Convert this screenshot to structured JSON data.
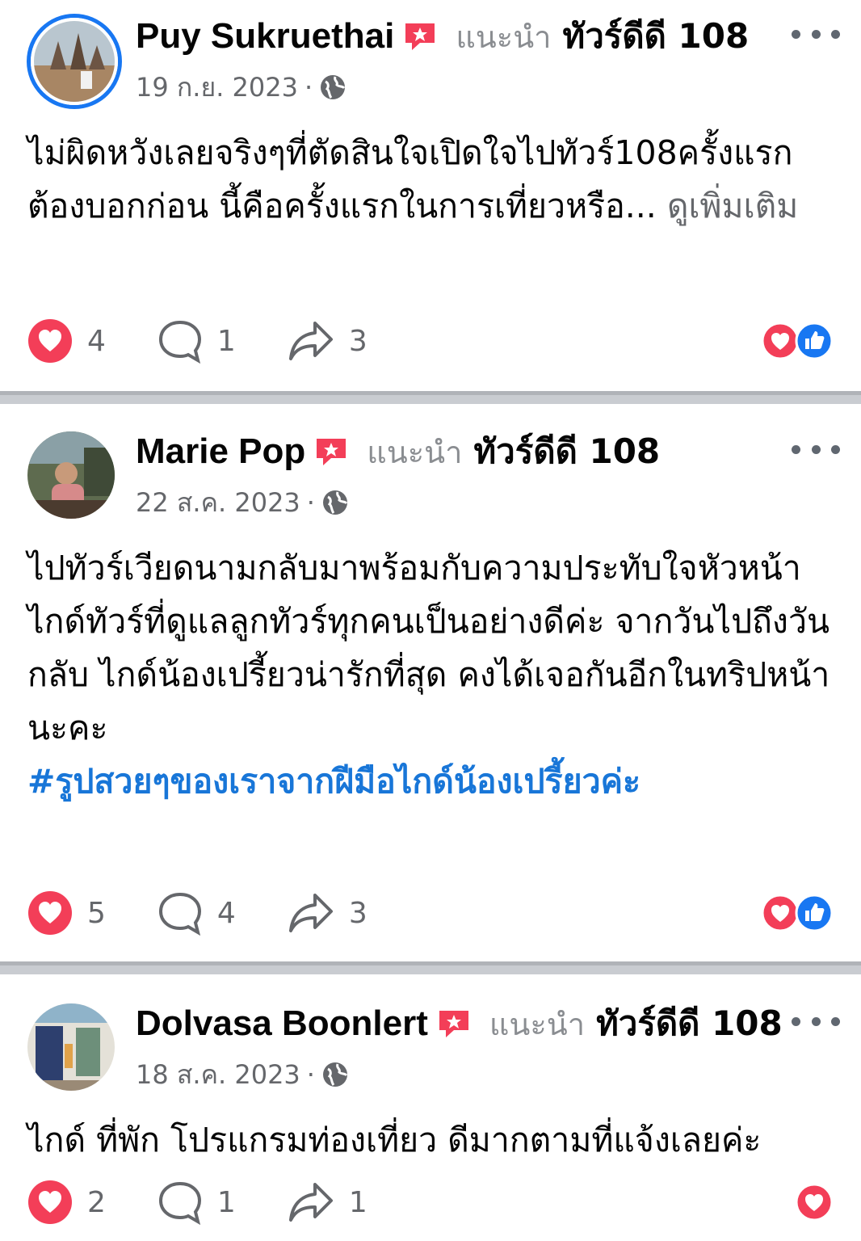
{
  "posts": [
    {
      "author": "Puy Sukruethai",
      "recommend": "แนะนำ",
      "page": "ทัวร์ดีดี 108",
      "date": "19 ก.ย. 2023",
      "sep": "·",
      "text": "ไม่ผิดหวังเลยจริงๆที่ตัดสินใจเปิดใจไปทัวร์108ครั้งแรก ต้องบอกก่อน นี้คือครั้งแรกในการเที่ยวหรือ... ",
      "see_more": "ดูเพิ่มเติม",
      "likes": "4",
      "comments": "1",
      "shares": "3"
    },
    {
      "author": "Marie Pop",
      "recommend": "แนะนำ",
      "page": "ทัวร์ดีดี 108",
      "date": "22 ส.ค. 2023",
      "sep": "·",
      "text": "ไปทัวร์เวียดนามกลับมาพร้อมกับความประทับใจหัวหน้าไกด์ทัวร์ที่ดูแลลูกทัวร์ทุกคนเป็นอย่างดีค่ะ จากวันไปถึงวันกลับ ไกด์น้องเปรี้ยวน่ารักที่สุด คงได้เจอกันอีกในทริปหน้านะคะ",
      "hashtag": "#รูปสวยๆของเราจากฝีมือไกด์น้องเปรี้ยวค่ะ",
      "likes": "5",
      "comments": "4",
      "shares": "3"
    },
    {
      "author": "Dolvasa Boonlert",
      "recommend": "แนะนำ",
      "page": "ทัวร์ดีดี 108",
      "date": "18 ส.ค. 2023",
      "sep": "·",
      "text": "ไกด์ ที่พัก โปรแกรมท่องเที่ยว ดีมากตามที่แจ้งเลยค่ะ",
      "likes": "2",
      "comments": "1",
      "shares": "1"
    }
  ],
  "colors": {
    "love": "#f33e58",
    "like": "#1877f2",
    "hashtag": "#1876d8",
    "muted": "#65676b",
    "divider": "#c9ccd1"
  },
  "icons": [
    "recommend-badge-icon",
    "globe-icon",
    "more-icon",
    "heart-icon",
    "comment-icon",
    "share-icon",
    "love-reaction-icon",
    "like-reaction-icon"
  ]
}
